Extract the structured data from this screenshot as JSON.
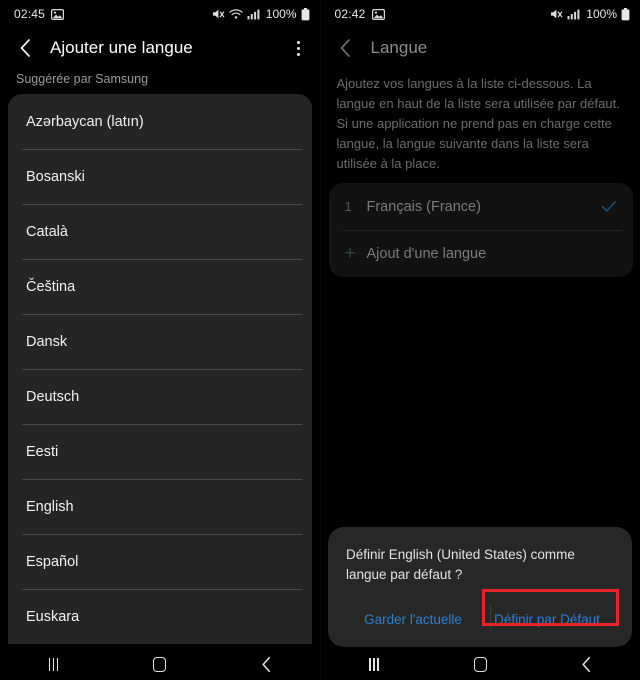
{
  "left": {
    "status": {
      "time": "02:45",
      "image_icon": "image-icon",
      "mute_icon": "mute-icon",
      "wifi_icon": "wifi-icon",
      "signal_icon": "signal-icon",
      "battery_percent": "100%",
      "battery_icon": "battery-icon"
    },
    "appbar": {
      "back_icon": "back-chevron-icon",
      "title": "Ajouter une langue",
      "overflow_icon": "overflow-menu-icon"
    },
    "section_label": "Suggérée par Samsung",
    "languages": [
      "Azərbaycan (latın)",
      "Bosanski",
      "Català",
      "Čeština",
      "Dansk",
      "Deutsch",
      "Eesti",
      "English",
      "Español",
      "Euskara"
    ]
  },
  "right": {
    "status": {
      "time": "02:42",
      "image_icon": "image-icon",
      "mute_icon": "mute-icon",
      "signal_icon": "signal-icon",
      "battery_percent": "100%",
      "battery_icon": "battery-icon"
    },
    "appbar": {
      "back_icon": "back-chevron-icon",
      "title": "Langue"
    },
    "description": "Ajoutez vos langues à la liste ci-dessous. La langue en haut de la liste sera utilisée par défaut. Si une application ne prend pas en charge cette langue, la langue suivante dans la liste sera utilisée à la place.",
    "selected_languages": [
      {
        "index": "1",
        "label": "Français (France)",
        "checked": true
      }
    ],
    "add_language": {
      "plus_icon": "plus-icon",
      "label": "Ajout d'une langue"
    },
    "dialog": {
      "message": "Définir English (United States) comme langue par défaut ?",
      "keep_button": "Garder l'actuelle",
      "set_default_button": "Définir par Défaut",
      "highlight_color": "#e8242b",
      "action_color": "#2f7fd4"
    }
  },
  "navbar": {
    "recents_icon": "recents-icon",
    "home_icon": "home-icon",
    "back_icon": "back-icon"
  }
}
